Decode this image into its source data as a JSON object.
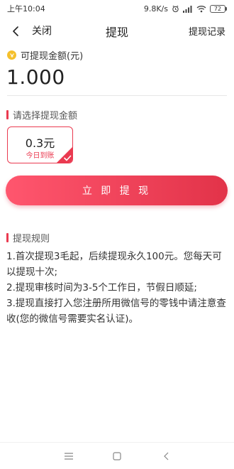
{
  "status_bar": {
    "time": "上午10:04",
    "network_speed": "9.8K/s",
    "battery": "72"
  },
  "nav": {
    "close_label": "关闭",
    "title": "提现",
    "records_label": "提现记录"
  },
  "balance": {
    "label": "可提现金额(元)",
    "amount": "1.000"
  },
  "select_section": {
    "title": "请选择提现金额",
    "options": [
      {
        "value": "0.3元",
        "sub": "今日到账",
        "selected": true
      }
    ]
  },
  "withdraw_button": "立 即 提 现",
  "rules": {
    "title": "提现规则",
    "items": [
      "1.首次提现3毛起，后续提现永久100元。您每天可以提现十次;",
      "2.提现审核时间为3-5个工作日，节假日顺延;",
      "3.提现直接打入您注册所用微信号的零钱中请注意查收(您的微信号需要实名认证)。"
    ]
  },
  "colors": {
    "accent": "#ea3a50",
    "coin": "#f5c02c"
  },
  "icons": [
    "back-arrow-icon",
    "coin-icon",
    "check-icon",
    "signal-icon",
    "wifi-icon",
    "alarm-icon",
    "battery-icon",
    "menu-icon",
    "home-icon",
    "back-icon"
  ]
}
